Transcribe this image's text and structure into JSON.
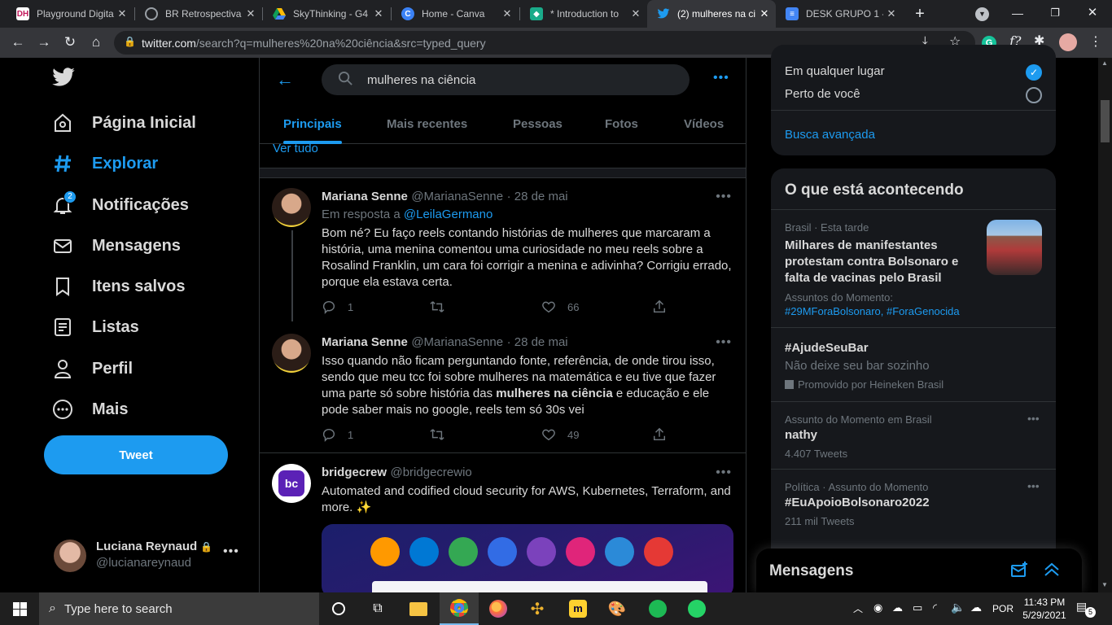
{
  "browser": {
    "tabs": [
      {
        "title": "Playground Digita",
        "icon": "dh-icon",
        "color": "#c2185b"
      },
      {
        "title": "BR Retrospectiva",
        "icon": "globe-icon",
        "color": "#5f6368"
      },
      {
        "title": "SkyThinking - G4",
        "icon": "drive-icon",
        "color": "#fbbc04"
      },
      {
        "title": "Home - Canva",
        "icon": "canva-icon",
        "color": "#3b82f6"
      },
      {
        "title": "* Introduction to",
        "icon": "shield-icon",
        "color": "#1aab8a"
      },
      {
        "title": "(2) mulheres na ci",
        "icon": "twitter-icon",
        "color": "#1d9bf0"
      },
      {
        "title": "DESK GRUPO 1 -",
        "icon": "docs-icon",
        "color": "#4285f4"
      }
    ],
    "url_host": "twitter.com",
    "url_path": "/search?q=mulheres%20na%20ciência&src=typed_query"
  },
  "sidebar": {
    "nav": [
      {
        "label": "Página Inicial",
        "icon": "home-icon"
      },
      {
        "label": "Explorar",
        "icon": "hashtag-icon"
      },
      {
        "label": "Notificações",
        "icon": "bell-icon",
        "badge": "2"
      },
      {
        "label": "Mensagens",
        "icon": "mail-icon"
      },
      {
        "label": "Itens salvos",
        "icon": "bookmark-icon"
      },
      {
        "label": "Listas",
        "icon": "list-icon"
      },
      {
        "label": "Perfil",
        "icon": "person-icon"
      },
      {
        "label": "Mais",
        "icon": "more-circle-icon"
      }
    ],
    "tweet_button": "Tweet",
    "account": {
      "name": "Luciana Reynaud",
      "handle": "@lucianareynaud"
    }
  },
  "search": {
    "query": "mulheres na ciência",
    "tabs": [
      "Principais",
      "Mais recentes",
      "Pessoas",
      "Fotos",
      "Vídeos"
    ],
    "see_all": "Ver tudo"
  },
  "tweets": [
    {
      "name": "Mariana Senne",
      "handle": "@MarianaSenne",
      "date": "· 28 de mai",
      "reply_prefix": "Em resposta a",
      "reply_to": "@LeilaGermano",
      "text": "Bom né? Eu faço reels contando histórias de mulheres que marcaram a história, uma menina comentou uma curiosidade no meu reels sobre a Rosalind Franklin, um cara foi corrigir a menina e adivinha? Corrigiu errado, porque ela estava certa.",
      "replies": "1",
      "likes": "66"
    },
    {
      "name": "Mariana Senne",
      "handle": "@MarianaSenne",
      "date": "· 28 de mai",
      "text_before": "Isso quando não ficam perguntando fonte, referência, de onde tirou isso, sendo que meu tcc foi sobre mulheres na matemática e eu tive que fazer uma parte só sobre história das ",
      "text_bold": "mulheres na ciência",
      "text_after": " e educação e ele pode saber mais no google, reels tem só 30s vei",
      "replies": "1",
      "likes": "49"
    },
    {
      "name": "bridgecrew",
      "handle": "@bridgecrewio",
      "text": "Automated and codified cloud security for AWS, Kubernetes, Terraform, and more. ✨",
      "avatar_text": "bc"
    }
  ],
  "right": {
    "location": {
      "option1": "Em qualquer lugar",
      "option2": "Perto de você",
      "advanced": "Busca avançada"
    },
    "happening_title": "O que está acontecendo",
    "trends": [
      {
        "meta": "Brasil · Esta tarde",
        "title": "Milhares de manifestantes protestam contra Bolsonaro e falta de vacinas pelo Brasil",
        "sub_label": "Assuntos do Momento:",
        "sub_tags": "#29MForaBolsonaro, #ForaGenocida"
      },
      {
        "title": "#AjudeSeuBar",
        "desc": "Não deixe seu bar sozinho",
        "promo": "Promovido por Heineken Brasil"
      },
      {
        "meta": "Assunto do Momento em Brasil",
        "title": "nathy",
        "count": "4.407 Tweets"
      },
      {
        "meta": "Política · Assunto do Momento",
        "title": "#EuApoioBolsonaro2022",
        "count": "211 mil Tweets"
      }
    ],
    "messages_title": "Mensagens"
  },
  "taskbar": {
    "search_placeholder": "Type here to search",
    "lang": "POR",
    "time": "11:43 PM",
    "date": "5/29/2021",
    "notifications": "5"
  },
  "colors": {
    "accent": "#1d9bf0",
    "bg": "#000000"
  }
}
